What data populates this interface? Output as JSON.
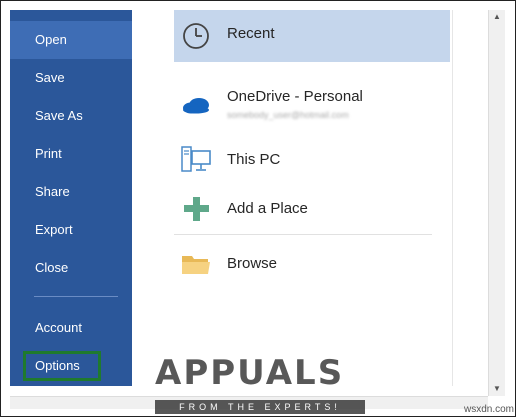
{
  "sidebar": {
    "items": [
      {
        "label": "Open"
      },
      {
        "label": "Save"
      },
      {
        "label": "Save As"
      },
      {
        "label": "Print"
      },
      {
        "label": "Share"
      },
      {
        "label": "Export"
      },
      {
        "label": "Close"
      },
      {
        "label": "Account"
      },
      {
        "label": "Options"
      }
    ],
    "active": "Open",
    "highlighted": "Options",
    "colors": {
      "background": "#2b579a",
      "active": "#3e6db5",
      "highlight_border": "#1f7a2e"
    }
  },
  "places": [
    {
      "label": "Recent",
      "icon": "clock-icon",
      "selected": true
    },
    {
      "label": "OneDrive - Personal",
      "sublabel": "somebody_user@hotmail.com",
      "icon": "cloud-icon"
    },
    {
      "label": "This PC",
      "icon": "computer-icon"
    },
    {
      "label": "Add a Place",
      "icon": "plus-icon"
    },
    {
      "label": "Browse",
      "icon": "folder-icon"
    }
  ],
  "watermark": {
    "brand": "APPUALS",
    "tagline": "FROM THE EXPERTS!"
  },
  "site_label": "wsxdn.com"
}
